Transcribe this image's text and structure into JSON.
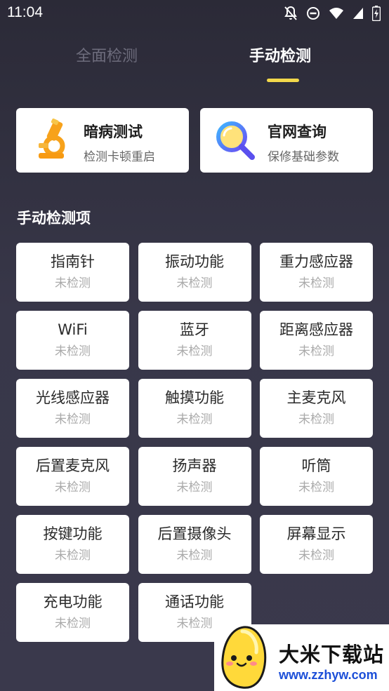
{
  "status_bar": {
    "time": "11:04"
  },
  "tabs": {
    "full": "全面检测",
    "manual": "手动检测"
  },
  "top_cards": [
    {
      "title": "暗病测试",
      "subtitle": "检测卡顿重启",
      "icon": "microscope-icon"
    },
    {
      "title": "官网查询",
      "subtitle": "保修基础参数",
      "icon": "magnifier-icon"
    }
  ],
  "section_title": "手动检测项",
  "items": [
    {
      "name": "指南针",
      "status": "未检测"
    },
    {
      "name": "振动功能",
      "status": "未检测"
    },
    {
      "name": "重力感应器",
      "status": "未检测"
    },
    {
      "name": "WiFi",
      "status": "未检测"
    },
    {
      "name": "蓝牙",
      "status": "未检测"
    },
    {
      "name": "距离感应器",
      "status": "未检测"
    },
    {
      "name": "光线感应器",
      "status": "未检测"
    },
    {
      "name": "触摸功能",
      "status": "未检测"
    },
    {
      "name": "主麦克风",
      "status": "未检测"
    },
    {
      "name": "后置麦克风",
      "status": "未检测"
    },
    {
      "name": "扬声器",
      "status": "未检测"
    },
    {
      "name": "听筒",
      "status": "未检测"
    },
    {
      "name": "按键功能",
      "status": "未检测"
    },
    {
      "name": "后置摄像头",
      "status": "未检测"
    },
    {
      "name": "屏幕显示",
      "status": "未检测"
    },
    {
      "name": "充电功能",
      "status": "未检测"
    },
    {
      "name": "通话功能",
      "status": "未检测"
    }
  ],
  "watermark": {
    "brand": "大米下载站",
    "url": "www.zzhyw.com"
  },
  "colors": {
    "accent": "#f2d84b",
    "background": "#383749",
    "url_blue": "#1c4fd8"
  }
}
